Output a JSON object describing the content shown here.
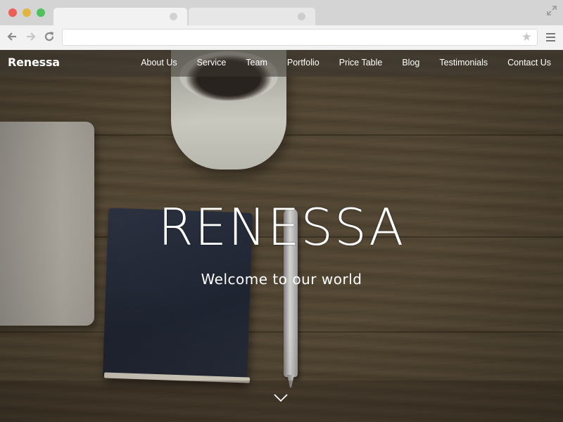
{
  "browser": {
    "tabs": [
      {
        "label": "",
        "active": true
      },
      {
        "label": "",
        "active": false
      }
    ],
    "address_value": ""
  },
  "site": {
    "brand": "Renessa",
    "nav": [
      "About Us",
      "Service",
      "Team",
      "Portfolio",
      "Price Table",
      "Blog",
      "Testimonials",
      "Contact Us"
    ],
    "hero": {
      "title": "RENESSA",
      "subtitle": "Welcome to our world"
    }
  },
  "icons": [
    "back-arrow-icon",
    "forward-arrow-icon",
    "reload-icon",
    "star-icon",
    "menu-icon",
    "fullscreen-icon",
    "chevron-down-icon"
  ]
}
